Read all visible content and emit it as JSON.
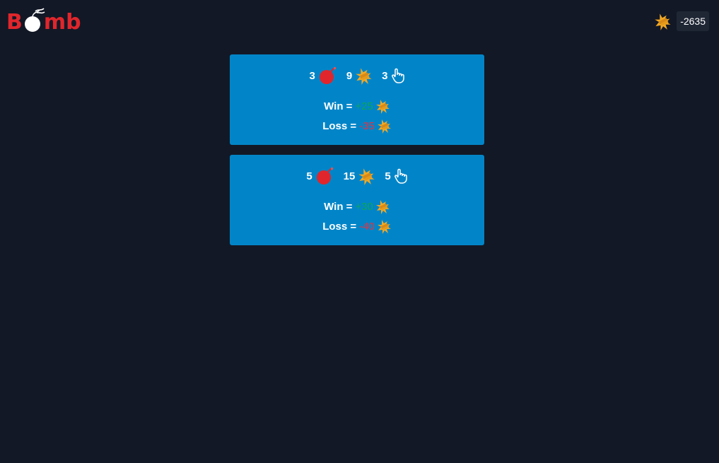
{
  "app": {
    "logo_prefix": "B",
    "logo_suffix": "mb",
    "brand_color": "#e0262c",
    "background": "#121826"
  },
  "header": {
    "balance_icon": "gold-bars-icon",
    "balance": "-2635"
  },
  "cards": [
    {
      "bombs": "3",
      "gold": "9",
      "clicks": "3",
      "win_label": "Win =",
      "win_value": "+25",
      "loss_label": "Loss =",
      "loss_value": "-35"
    },
    {
      "bombs": "5",
      "gold": "15",
      "clicks": "5",
      "win_label": "Win =",
      "win_value": "+30",
      "loss_label": "Loss =",
      "loss_value": "-40"
    }
  ],
  "colors": {
    "card": "#0285c8",
    "win": "#0ca55a",
    "loss": "#e8313f",
    "gold": "#f2a823"
  },
  "icons": [
    "bomb-icon",
    "gold-bars-icon",
    "hand-pointer-icon"
  ]
}
